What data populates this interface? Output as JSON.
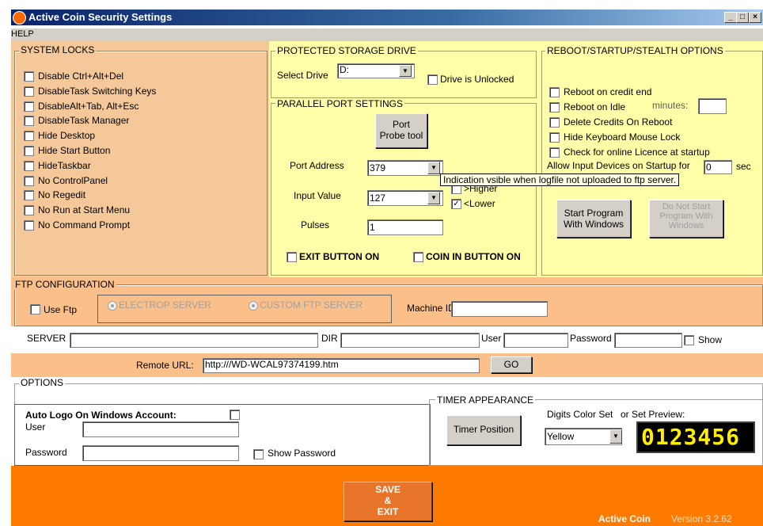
{
  "window": {
    "title": "Active Coin Security Settings",
    "minimize": "_",
    "maximize": "□",
    "close": "×"
  },
  "menu": {
    "help": "HELP"
  },
  "system_locks": {
    "title": "SYSTEM LOCKS",
    "items": [
      "Disable Ctrl+Alt+Del",
      "DisableTask Switching Keys",
      "DisableAlt+Tab, Alt+Esc",
      "DisableTask Manager",
      "Hide Desktop",
      "Hide Start Button",
      "HideTaskbar",
      "No ControlPanel",
      "No Regedit",
      "No Run at Start Menu",
      "No Command Prompt"
    ]
  },
  "storage": {
    "title": "PROTECTED STORAGE DRIVE",
    "select_label": "Select Drive",
    "drive_value": "D:",
    "unlocked_label": "Drive is Unlocked"
  },
  "parallel": {
    "title": "PARALLEL PORT SETTINGS",
    "probe_line1": "Port",
    "probe_line2": "Probe tool",
    "port_address_label": "Port Address",
    "port_address_value": "379",
    "input_value_label": "Input Value",
    "input_value": "127",
    "higher_label": ">Higher",
    "lower_label": "<Lower",
    "lower_checked": "✓",
    "pulses_label": "Pulses",
    "pulses_value": "1",
    "exit_button_label": "EXIT BUTTON ON",
    "coin_button_label": "COIN IN BUTTON ON"
  },
  "tooltip": "Indication vsible when logfile not uploaded to ftp server.",
  "reboot": {
    "title": "REBOOT/STARTUP/STEALTH OPTIONS",
    "items": [
      "Reboot on credit end",
      "Reboot on Idle",
      "Delete Credits On Reboot",
      "Hide Keyboard Mouse Lock",
      "Check for online Licence at startup"
    ],
    "minutes_label": "minutes:",
    "allow_input_label": "Allow Input Devices on Startup for",
    "allow_input_value": "0",
    "sec_label": "sec",
    "start_btn_line1": "Start Program",
    "start_btn_line2": "With Windows",
    "nostart_btn_line1": "Do Not Start",
    "nostart_btn_line2": "Program With",
    "nostart_btn_line3": "Windows"
  },
  "ftp": {
    "title": "FTP CONFIGURATION",
    "use_ftp": "Use Ftp",
    "electrop": "ELECTROP SERVER",
    "custom": "CUSTOM FTP SERVER",
    "machine_id_label": "Machine ID",
    "server_label": "SERVER",
    "dir_label": "DIR",
    "user_label": "User",
    "password_label": "Password",
    "show_label": "Show",
    "remote_url_label": "Remote URL:",
    "remote_url_value": "http:///WD-WCAL97374199.htm",
    "go_label": "GO"
  },
  "options": {
    "title": "OPTIONS",
    "auto_logo_label": "Auto Logo On Windows Account:",
    "user_label": "User",
    "password_label": "Password",
    "show_password_label": "Show Password"
  },
  "timer": {
    "title": "TIMER APPEARANCE",
    "position_btn": "Timer Position",
    "digits_color_label": "Digits Color Set",
    "preview_label": "or Set Preview:",
    "color_value": "Yellow",
    "preview_digits": "0123456",
    "digit_color": "#ffee00"
  },
  "footer": {
    "save_line1": "SAVE",
    "save_line2": "&",
    "save_line3": "EXIT",
    "brand": "Active Coin",
    "version": "Version 3.2.62"
  },
  "colors": {
    "panel_orange": "#f5c89a",
    "panel_yellow": "#fefea8",
    "bar_orange": "#fbbf8a",
    "footer_orange": "#ff7a00",
    "save_btn": "#e8742a"
  }
}
